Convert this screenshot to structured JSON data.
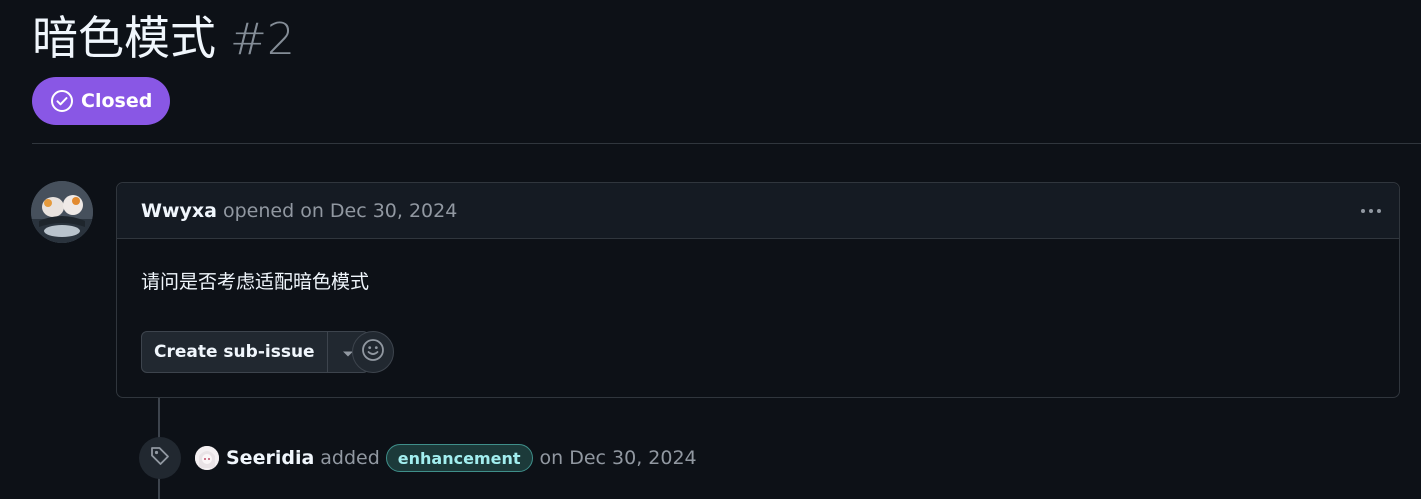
{
  "issue": {
    "title": "暗色模式",
    "number": "#2",
    "state": "Closed"
  },
  "comment": {
    "author": "Wwyxa",
    "meta": "opened on Dec 30, 2024",
    "body": "请问是否考虑适配暗色模式"
  },
  "actions": {
    "create_sub_issue": "Create sub-issue"
  },
  "timeline_event": {
    "actor": "Seeridia",
    "verb": "added",
    "label": "enhancement",
    "date": "on Dec 30, 2024"
  },
  "colors": {
    "background": "#0d1117",
    "closed_badge": "#8957e5",
    "label_text": "#a2eeef"
  },
  "icons": {
    "state": "check-circle-icon",
    "menu": "kebab-horizontal-icon",
    "caret": "triangle-down-icon",
    "reaction": "smiley-icon",
    "event": "tag-icon"
  }
}
